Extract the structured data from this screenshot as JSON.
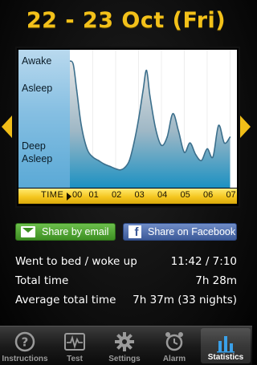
{
  "header": {
    "title": "22 - 23 Oct (Fri)"
  },
  "chart": {
    "levels": {
      "awake": "Awake",
      "asleep": "Asleep",
      "deep": "Deep\nAsleep"
    },
    "time_prefix": "TIME",
    "hours": [
      "00",
      "01",
      "02",
      "03",
      "04",
      "05",
      "06",
      "07"
    ],
    "colors": {
      "accent": "#f3c11a",
      "fill_top": "#d8d8d8",
      "fill_bottom": "#1a8fbf",
      "line": "#3b6f8c"
    }
  },
  "chart_data": {
    "type": "area",
    "x": [
      0.0,
      0.15,
      0.3,
      0.5,
      0.75,
      1.0,
      1.25,
      1.5,
      1.75,
      2.0,
      2.2,
      2.4,
      2.6,
      2.8,
      3.0,
      3.2,
      3.35,
      3.5,
      3.75,
      4.0,
      4.25,
      4.5,
      4.75,
      5.0,
      5.25,
      5.5,
      5.75,
      6.0,
      6.25,
      6.5,
      6.75,
      7.0
    ],
    "y": [
      1.0,
      0.97,
      0.75,
      0.45,
      0.25,
      0.18,
      0.15,
      0.12,
      0.1,
      0.08,
      0.07,
      0.09,
      0.15,
      0.3,
      0.5,
      0.75,
      0.92,
      0.7,
      0.42,
      0.28,
      0.35,
      0.55,
      0.4,
      0.22,
      0.3,
      0.2,
      0.15,
      0.25,
      0.18,
      0.45,
      0.3,
      0.35
    ],
    "x_tick_labels": [
      "00",
      "01",
      "02",
      "03",
      "04",
      "05",
      "06",
      "07"
    ],
    "y_tick_labels": [
      "Awake",
      "Asleep",
      "Deep Asleep"
    ],
    "xlim": [
      0,
      7.3
    ],
    "ylim": [
      0,
      1
    ]
  },
  "share": {
    "email_label": "Share by email",
    "facebook_label": "Share on Facebook"
  },
  "stats": [
    {
      "label": "Went to bed / woke up",
      "value": "11:42 / 7:10"
    },
    {
      "label": "Total time",
      "value": "7h 28m"
    },
    {
      "label": "Average total time",
      "value": "7h 37m (33 nights)"
    }
  ],
  "tabs": [
    {
      "label": "Instructions",
      "icon": "question-icon"
    },
    {
      "label": "Test",
      "icon": "pulse-icon"
    },
    {
      "label": "Settings",
      "icon": "gear-icon"
    },
    {
      "label": "Alarm",
      "icon": "alarm-clock-icon"
    },
    {
      "label": "Statistics",
      "icon": "bar-chart-icon",
      "active": true
    }
  ]
}
